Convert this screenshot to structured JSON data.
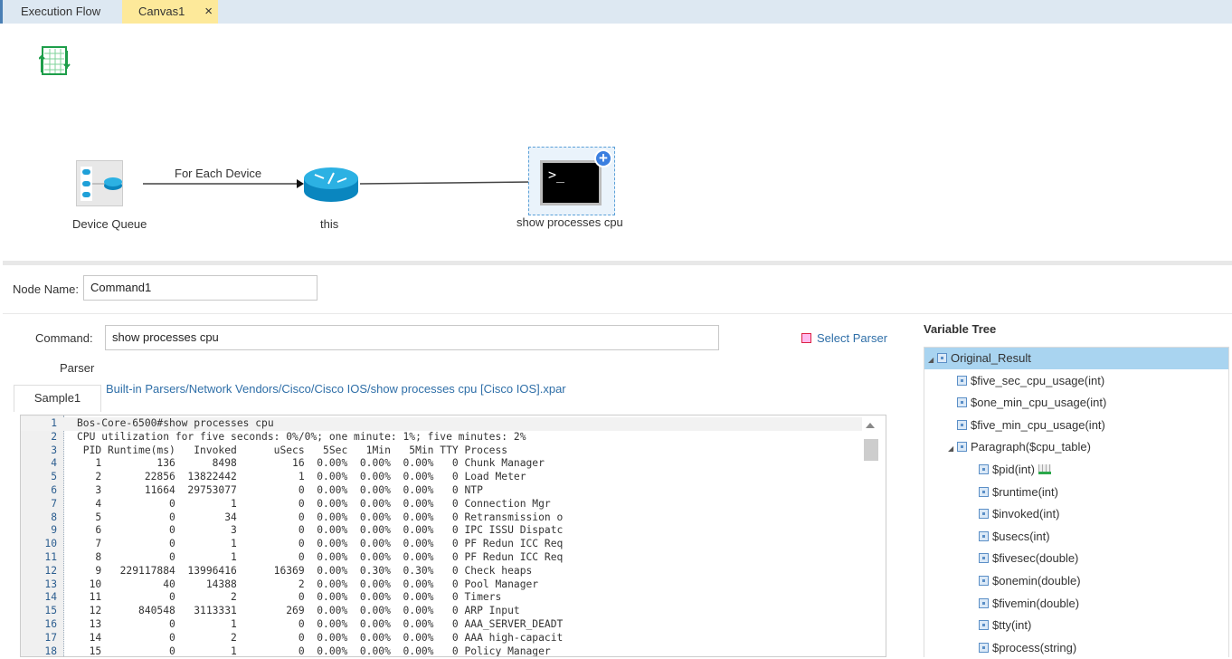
{
  "tabs": [
    {
      "label": "Execution Flow"
    },
    {
      "label": "Canvas1",
      "close": "×"
    }
  ],
  "flow": {
    "nodes": {
      "device_queue": "Device Queue",
      "this": "this",
      "command": "show processes cpu"
    },
    "edge_label": "For Each Device",
    "terminal_prompt": ">_"
  },
  "form": {
    "node_name_label": "Node Name:",
    "node_name_value": "Command1",
    "command_label": "Command:",
    "command_value": "show processes cpu",
    "select_parser": "Select Parser",
    "parser_label": "Parser",
    "parser_path": "Built-in Parsers/Network Vendors/Cisco/Cisco IOS/show processes cpu [Cisco IOS].xpar",
    "sample_tab": "Sample1"
  },
  "code_lines": [
    "Bos-Core-6500#show processes cpu",
    "CPU utilization for five seconds: 0%/0%; one minute: 1%; five minutes: 2%",
    " PID Runtime(ms)   Invoked      uSecs   5Sec   1Min   5Min TTY Process",
    "   1         136      8498         16  0.00%  0.00%  0.00%   0 Chunk Manager",
    "   2       22856  13822442          1  0.00%  0.00%  0.00%   0 Load Meter",
    "   3       11664  29753077          0  0.00%  0.00%  0.00%   0 NTP",
    "   4           0         1          0  0.00%  0.00%  0.00%   0 Connection Mgr",
    "   5           0        34          0  0.00%  0.00%  0.00%   0 Retransmission o",
    "   6           0         3          0  0.00%  0.00%  0.00%   0 IPC ISSU Dispatc",
    "   7           0         1          0  0.00%  0.00%  0.00%   0 PF Redun ICC Req",
    "   8           0         1          0  0.00%  0.00%  0.00%   0 PF Redun ICC Req",
    "   9   229117884  13996416      16369  0.00%  0.30%  0.30%   0 Check heaps",
    "  10          40     14388          2  0.00%  0.00%  0.00%   0 Pool Manager",
    "  11           0         2          0  0.00%  0.00%  0.00%   0 Timers",
    "  12      840548   3113331        269  0.00%  0.00%  0.00%   0 ARP Input",
    "  13           0         1          0  0.00%  0.00%  0.00%   0 AAA_SERVER_DEADT",
    "  14           0         2          0  0.00%  0.00%  0.00%   0 AAA high-capacit",
    "  15           0         1          0  0.00%  0.00%  0.00%   0 Policy Manager"
  ],
  "variable_tree": {
    "title": "Variable Tree",
    "items": [
      {
        "label": "Original_Result",
        "level": 0,
        "expanded": true,
        "selected": true
      },
      {
        "label": "$five_sec_cpu_usage(int)",
        "level": 1
      },
      {
        "label": "$one_min_cpu_usage(int)",
        "level": 1
      },
      {
        "label": "$five_min_cpu_usage(int)",
        "level": 1
      },
      {
        "label": "Paragraph($cpu_table)",
        "level": 1,
        "expanded": true
      },
      {
        "label": "$pid(int)",
        "level": 2,
        "key": true
      },
      {
        "label": "$runtime(int)",
        "level": 2
      },
      {
        "label": "$invoked(int)",
        "level": 2
      },
      {
        "label": "$usecs(int)",
        "level": 2
      },
      {
        "label": "$fivesec(double)",
        "level": 2
      },
      {
        "label": "$onemin(double)",
        "level": 2
      },
      {
        "label": "$fivemin(double)",
        "level": 2
      },
      {
        "label": "$tty(int)",
        "level": 2
      },
      {
        "label": "$process(string)",
        "level": 2
      }
    ]
  },
  "colors": {
    "tab_active": "#fde99a",
    "tree_selected": "#a9d4f0",
    "link": "#2f6fa8"
  }
}
